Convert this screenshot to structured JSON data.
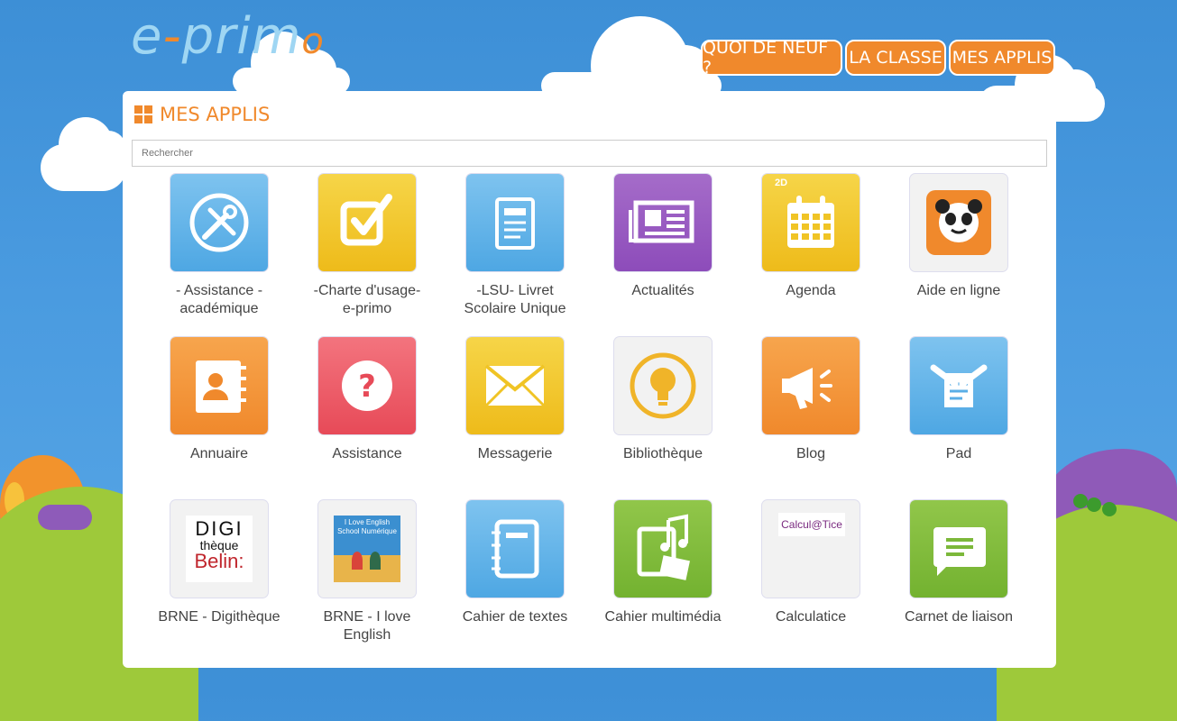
{
  "logo": {
    "text_a": "e",
    "text_dash": "-",
    "text_b": "prim",
    "text_o": "o"
  },
  "nav": [
    {
      "label": "QUOI DE NEUF ?"
    },
    {
      "label": "LA CLASSE"
    },
    {
      "label": "MES APPLIS"
    }
  ],
  "panel": {
    "title": "MES APPLIS",
    "title_icon": "grid-icon"
  },
  "search": {
    "placeholder": "Rechercher",
    "value": ""
  },
  "apps": [
    {
      "label": "- Assistance -\nacadémique",
      "icon": "tools-icon",
      "color": "#5aaee6"
    },
    {
      "label": "-Charte d'usage-\ne-primo",
      "icon": "checkbox-icon",
      "color": "#f0c425"
    },
    {
      "label": "-LSU- Livret\nScolaire Unique",
      "icon": "document-icon",
      "color": "#5aaee6"
    },
    {
      "label": "Actualités",
      "icon": "newspaper-icon",
      "color": "#9a5cc2"
    },
    {
      "label": "Agenda",
      "icon": "calendar-icon",
      "color": "#f0c425",
      "badge": "2D"
    },
    {
      "label": "Aide en ligne",
      "icon": "panda-icon",
      "color": "#f0892c"
    },
    {
      "label": "Annuaire",
      "icon": "contacts-icon",
      "color": "#f0892c"
    },
    {
      "label": "Assistance",
      "icon": "question-icon",
      "color": "#e74a58"
    },
    {
      "label": "Messagerie",
      "icon": "envelope-icon",
      "color": "#f0c425"
    },
    {
      "label": "Bibliothèque",
      "icon": "lightbulb-icon",
      "color": "#f0b429"
    },
    {
      "label": "Blog",
      "icon": "megaphone-icon",
      "color": "#f0892c"
    },
    {
      "label": "Pad",
      "icon": "pad-icon",
      "color": "#5aaee6"
    },
    {
      "label": "BRNE - Digithèque",
      "icon": "digitheque-logo",
      "logo_lines": [
        "DIGI",
        "thèque",
        "Belin:"
      ]
    },
    {
      "label": "BRNE - I love\nEnglish",
      "icon": "ilove-english-cover",
      "cover_text": "I Love English School Numérique"
    },
    {
      "label": "Cahier de textes",
      "icon": "notebook-icon",
      "color": "#5aaee6"
    },
    {
      "label": "Cahier multimédia",
      "icon": "multimedia-notebook-icon",
      "color": "#7cb83a"
    },
    {
      "label": "Calculatice",
      "icon": "calculatice-logo",
      "logo_text": "Calcul@Tice"
    },
    {
      "label": "Carnet de liaison",
      "icon": "chat-bubble-icon",
      "color": "#7cb83a"
    }
  ]
}
